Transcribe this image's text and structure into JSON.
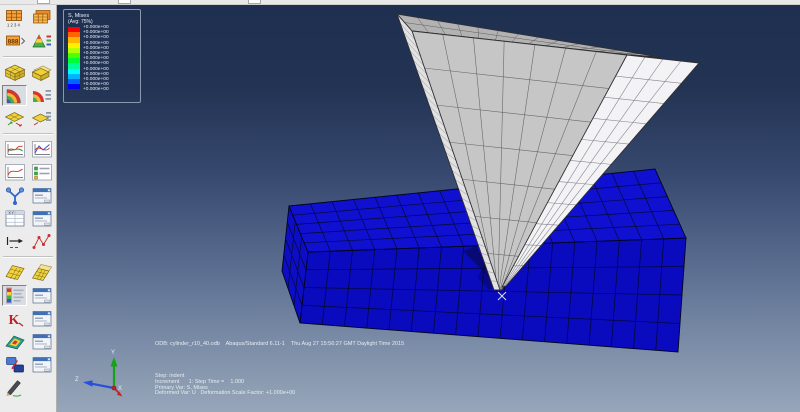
{
  "legend": {
    "title": "S, Mises",
    "subtitle": "(Avg: 75%)",
    "colors": [
      "#ff0000",
      "#ff6400",
      "#ffb400",
      "#fff000",
      "#b4ff00",
      "#50ff00",
      "#00ff36",
      "#00ff9b",
      "#00ffff",
      "#00b4ff",
      "#0064ff",
      "#0000ff"
    ],
    "labels": [
      "+0.000e+00",
      "+0.000e+00",
      "+0.000e+00",
      "+0.000e+00",
      "+0.000e+00",
      "+0.000e+00",
      "+0.000e+00",
      "+0.000e+00",
      "+0.000e+00",
      "+0.000e+00",
      "+0.000e+00",
      "+0.000e+00",
      "+0.000e+00"
    ]
  },
  "viewport": {
    "odb_line": "ODB: cylinder_r10_40.odb    Abaqus/Standard 6.11-1    Thu Aug 27 15:56:27 GMT Daylight Time 2015",
    "state_lines": [
      "Step: indent",
      "Increment      1: Step Time =    1.000",
      "Primary Var: S, Mises",
      "Deformed Var: U   Deformation Scale Factor: +1.000e+00"
    ],
    "triad": {
      "x_label": "X",
      "y_label": "Y",
      "z_label": "Z"
    },
    "colors": {
      "background_top": "#1e2f50",
      "background_bottom": "#97a6b9",
      "block_top": "#1010d0",
      "block_front": "#0a0abe",
      "block_side": "#0d0dc6",
      "mesh_line": "#04081c",
      "tool_top": "#b2b2b2",
      "tool_face": "#c6c6c6",
      "tool_side": "#f3f3f5",
      "tool_hatch": "#e2e2e2",
      "legend_border": "#8a99ac",
      "marker": "#e2e7f0"
    }
  },
  "toolbar": {
    "rows": [
      {
        "left": {
          "name": "result-frames-grid"
        },
        "right": {
          "name": "result-frames-stack"
        }
      },
      {
        "left": {
          "name": "frame-selector"
        },
        "right": {
          "name": "result-options"
        }
      },
      {
        "sep": true
      },
      {
        "left": {
          "name": "plot-undeformed"
        },
        "right": {
          "name": "plot-deformed"
        }
      },
      {
        "left": {
          "name": "plot-contours",
          "selected": true
        },
        "right": {
          "name": "contour-options"
        }
      },
      {
        "left": {
          "name": "plot-symbols"
        },
        "right": {
          "name": "symbol-options"
        }
      },
      {
        "sep": true
      },
      {
        "left": {
          "name": "xy-data-create"
        },
        "right": {
          "name": "xy-plot"
        }
      },
      {
        "left": {
          "name": "xy-chart"
        },
        "right": {
          "name": "xy-options"
        }
      },
      {
        "left": {
          "name": "overlay-tree"
        },
        "right": {
          "name": "overlay-dialog"
        }
      },
      {
        "left": {
          "name": "xy-table"
        },
        "right": {
          "name": "table-dialog"
        }
      },
      {
        "left": {
          "name": "path-arrow"
        },
        "right": {
          "name": "path-points"
        }
      },
      {
        "sep": true
      },
      {
        "left": {
          "name": "view-cut-a"
        },
        "right": {
          "name": "view-cut-b"
        }
      },
      {
        "left": {
          "name": "contour-spectrum",
          "selected": true
        },
        "right": {
          "name": "spectrum-dialog"
        }
      },
      {
        "left": {
          "name": "free-body-k"
        },
        "right": {
          "name": "free-body-dialog"
        }
      },
      {
        "left": {
          "name": "stream-contour"
        },
        "right": {
          "name": "stream-dialog"
        }
      },
      {
        "left": {
          "name": "swap-views"
        },
        "right": {
          "name": "swap-dialog"
        }
      },
      {
        "left": {
          "name": "probe-pencil"
        }
      }
    ]
  }
}
